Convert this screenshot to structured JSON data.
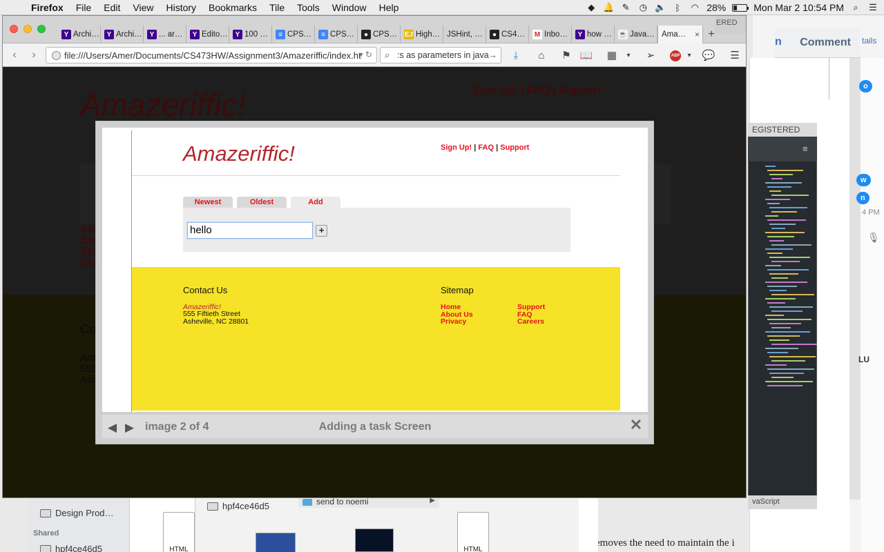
{
  "menubar": {
    "app": "Firefox",
    "items": [
      "File",
      "Edit",
      "View",
      "History",
      "Bookmarks",
      "Tile",
      "Tools",
      "Window",
      "Help"
    ],
    "battery": "28%",
    "battery_level": 0.28,
    "clock": "Mon Mar 2  10:54 PM"
  },
  "browser": {
    "tabs": [
      {
        "label": "Archi…",
        "icon": "yahoo-icon"
      },
      {
        "label": "Archi…",
        "icon": "yahoo-icon"
      },
      {
        "label": "... ar…",
        "icon": "yahoo-icon"
      },
      {
        "label": "Edito…",
        "icon": "yahoo-icon"
      },
      {
        "label": "100 …",
        "icon": "yahoo-icon"
      },
      {
        "label": "CPS…",
        "icon": "google-docs-icon"
      },
      {
        "label": "CPS…",
        "icon": "google-docs-icon"
      },
      {
        "label": "CPS…",
        "icon": "github-icon"
      },
      {
        "label": "High…",
        "icon": "ejs-icon"
      },
      {
        "label": "JSHint, …",
        "icon": ""
      },
      {
        "label": "CS4…",
        "icon": "github-icon"
      },
      {
        "label": "Inbo…",
        "icon": "gmail-icon"
      },
      {
        "label": "how …",
        "icon": "yahoo-icon"
      },
      {
        "label": "Java…",
        "icon": "java-icon"
      },
      {
        "label": "Ama…",
        "icon": "",
        "active": true
      }
    ],
    "tab_overflow_text": "ERED",
    "url": "file:///Users/Amer/Documents/CS473HW/Assignment3/Amazeriffic/index.ht",
    "search_value": ":s as parameters in java"
  },
  "dimmed_page": {
    "title": "Amazeriffic!",
    "nav": "Sign Up! | FAQ | Support",
    "scr_lines": [
      "Scr",
      "Scr",
      "Scr",
      "Scr"
    ],
    "contact": "Co",
    "addr_lines": [
      "Am",
      "555",
      "Ash"
    ]
  },
  "lightbox": {
    "counter": "image 2 of 4",
    "caption": "Adding a task Screen",
    "page": {
      "logo": "Amazeriffic!",
      "nav": {
        "signup": "Sign Up!",
        "faq": "FAQ",
        "support": "Support",
        "sep": "|"
      },
      "tabs": [
        "Newest",
        "Oldest",
        "Add"
      ],
      "input_value": "hello",
      "add_button": "+",
      "footer": {
        "contact_heading": "Contact Us",
        "contact_name": "Amazeriffic!",
        "address": [
          "555 Fiftieth Street",
          "Asheville, NC 28801"
        ],
        "sitemap_heading": "Sitemap",
        "links_col1": [
          "Home",
          "About Us",
          "Privacy"
        ],
        "links_col2": [
          "Support",
          "FAQ",
          "Careers"
        ]
      }
    }
  },
  "background": {
    "comment_label": "Comment",
    "comment_partial": "n",
    "details_partial": "tails",
    "editor_header": "EGISTERED",
    "editor_footer": "vaScript",
    "bubbles": [
      "o",
      "w",
      "n"
    ],
    "bubble_time": "4 PM",
    "lu_text": "LU",
    "book_text": "emoves the need to maintain the i",
    "finder_sidebar": [
      "Design Prod…"
    ],
    "finder_shared_heading": "Shared",
    "finder_shared_item": "hpf4ce46d5",
    "finder2_item": "hpf4ce46d5",
    "finder2_bar": "send to noemi",
    "file_labels": [
      "HTML",
      "HTML"
    ]
  }
}
